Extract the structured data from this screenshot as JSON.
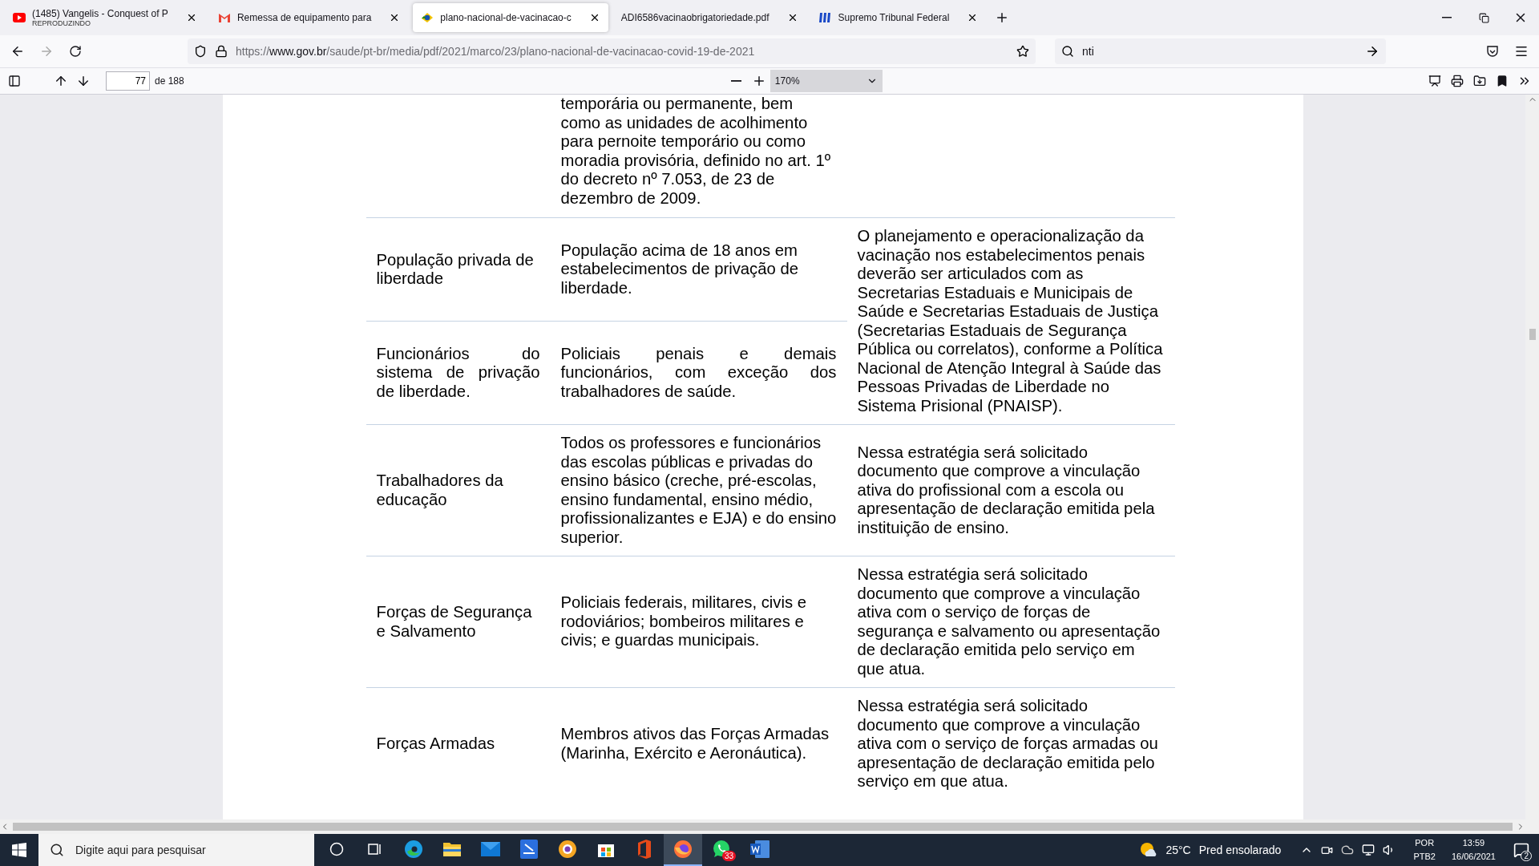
{
  "browser": {
    "tabs": [
      {
        "kind": "video",
        "title": "(1485) Vangelis - Conquest of P",
        "subtitle": "REPRODUZINDO",
        "selected": false
      },
      {
        "kind": "mail",
        "title": "Remessa de equipamento para",
        "selected": false
      },
      {
        "kind": "flag",
        "title": "plano-nacional-de-vacinacao-c",
        "selected": true
      },
      {
        "kind": "none",
        "title": "ADI6586vacinaobrigatoriedade.pdf",
        "selected": false
      },
      {
        "kind": "court",
        "title": "Supremo Tribunal Federal",
        "selected": false
      }
    ],
    "url": {
      "scheme": "https://",
      "domain": "www.gov.br",
      "path": "/saude/pt-br/media/pdf/2021/marco/23/plano-nacional-de-vacinacao-covid-19-de-2021"
    },
    "search": {
      "value": "nti"
    }
  },
  "pdf_toolbar": {
    "page": "77",
    "page_count": "de 188",
    "zoom": "170%"
  },
  "document": {
    "lead_in": [
      "temporária ou permanente, bem",
      "como as unidades de acolhimento",
      "para pernoite temporário ou como",
      "moradia provisória, definido no art. 1º",
      "do decreto nº 7.053, de 23 de",
      "dezembro de 2009."
    ],
    "groups": [
      {
        "notes": "O planejamento e operacionalização da vacinação nos estabelecimentos penais deverão ser articulados com as Secretarias Estaduais e Municipais de Saúde e Secretarias Estaduais de Justiça (Secretarias Estaduais de Segurança Pública ou correlatos), conforme a Política Nacional de Atenção Integral à Saúde das Pessoas Privadas de Liberdade no Sistema Prisional (PNAISP).",
        "rows": [
          {
            "group": "População privada de liberdade",
            "description": "População acima de 18 anos em estabelecimentos de privação de liberdade.",
            "justified": false
          },
          {
            "group": "Funcionários do sistema de privação de liberdade.",
            "description": "Policiais penais e demais funcionários, com exceção dos trabalhadores de saúde.",
            "justified": true
          }
        ]
      },
      {
        "notes": "Nessa estratégia será solicitado documento que comprove a vinculação ativa do profissional com a escola ou apresentação de declaração emitida pela instituição de ensino.",
        "rows": [
          {
            "group": "Trabalhadores da educação",
            "description": "Todos os professores e funcionários das escolas públicas e privadas do ensino básico (creche, pré-escolas, ensino fundamental, ensino médio, profissionalizantes e EJA) e do ensino superior.",
            "justified": false
          }
        ]
      },
      {
        "notes": "Nessa estratégia será solicitado documento que comprove a vinculação ativa com o serviço de forças de segurança e salvamento ou apresentação de declaração emitida pelo serviço em que atua.",
        "rows": [
          {
            "group": "Forças de Segurança e Salvamento",
            "description": "Policiais federais, militares, civis e rodoviários; bombeiros militares e civis; e guardas municipais.",
            "justified": false
          }
        ]
      },
      {
        "notes": "Nessa estratégia será solicitado documento que comprove a vinculação ativa com o serviço de forças armadas ou apresentação de declaração emitida pelo serviço em que atua.",
        "rows": [
          {
            "group": "Forças Armadas",
            "description": "Membros ativos das Forças Armadas (Marinha, Exército e Aeronáutica)."
          }
        ]
      }
    ]
  },
  "taskbar": {
    "search_placeholder": "Digite aqui para pesquisar",
    "apps": [
      {
        "kind": "cortana",
        "selected": false
      },
      {
        "kind": "task-view",
        "selected": false
      },
      {
        "kind": "edge",
        "selected": false
      },
      {
        "kind": "folder",
        "selected": false
      },
      {
        "kind": "mail",
        "selected": false
      },
      {
        "kind": "scanner",
        "selected": false
      },
      {
        "kind": "orange-browser",
        "selected": false
      },
      {
        "kind": "store",
        "selected": false
      },
      {
        "kind": "office",
        "selected": false
      },
      {
        "kind": "firefox",
        "selected": true
      },
      {
        "kind": "chat",
        "selected": false,
        "badge": "33"
      },
      {
        "kind": "word",
        "selected": false
      }
    ],
    "weather": {
      "temperature": "25°C",
      "condition": "Pred ensolarado"
    },
    "language": "POR",
    "layout": "PTB2",
    "time": "13:59",
    "date": "16/06/2021",
    "notifications": "2"
  }
}
